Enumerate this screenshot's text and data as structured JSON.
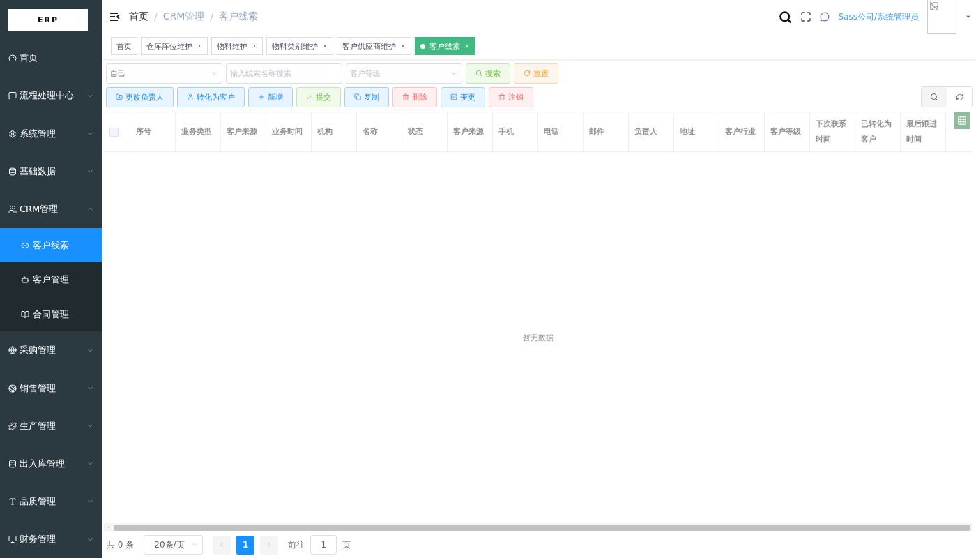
{
  "logo": {
    "text": "ERP"
  },
  "sidebar": {
    "items": [
      {
        "label": "首页"
      },
      {
        "label": "流程处理中心",
        "expanded": false
      },
      {
        "label": "系统管理",
        "expanded": false
      },
      {
        "label": "基础数据",
        "expanded": false
      },
      {
        "label": "CRM管理",
        "expanded": true,
        "children": [
          {
            "label": "客户线索",
            "selected": true
          },
          {
            "label": "客户管理",
            "selected": false
          },
          {
            "label": "合同管理",
            "selected": false
          }
        ]
      },
      {
        "label": "采购管理",
        "expanded": false
      },
      {
        "label": "销售管理",
        "expanded": false
      },
      {
        "label": "生产管理",
        "expanded": false
      },
      {
        "label": "出入库管理",
        "expanded": false
      },
      {
        "label": "品质管理",
        "expanded": false
      },
      {
        "label": "财务管理",
        "expanded": false
      }
    ]
  },
  "breadcrumb": {
    "items": [
      "首页",
      "CRM管理",
      "客户线索"
    ],
    "separator": "/"
  },
  "user": {
    "name": "Sass公司/系统管理员"
  },
  "tabs": [
    {
      "label": "首页",
      "selected": false,
      "closable": false
    },
    {
      "label": "仓库库位维护",
      "selected": false,
      "closable": true
    },
    {
      "label": "物料维护",
      "selected": false,
      "closable": true
    },
    {
      "label": "物料类别维护",
      "selected": false,
      "closable": true
    },
    {
      "label": "客户供应商维护",
      "selected": false,
      "closable": true
    },
    {
      "label": "客户线索",
      "selected": true,
      "closable": true
    }
  ],
  "filters": {
    "owner": {
      "value": "自己"
    },
    "search": {
      "placeholder": "输入线索名称搜索"
    },
    "level": {
      "placeholder": "客户等级"
    },
    "buttons": [
      {
        "label": "搜索",
        "kind": "success"
      },
      {
        "label": "重置",
        "kind": "warning"
      }
    ]
  },
  "actions": [
    {
      "label": "更改负责人",
      "kind": "primary"
    },
    {
      "label": "转化为客户",
      "kind": "primary"
    },
    {
      "label": "新增",
      "kind": "primary"
    },
    {
      "label": "提交",
      "kind": "success"
    },
    {
      "label": "复制",
      "kind": "primary"
    },
    {
      "label": "删除",
      "kind": "danger"
    },
    {
      "label": "变更",
      "kind": "primary"
    },
    {
      "label": "注销",
      "kind": "danger"
    }
  ],
  "table": {
    "select_all": {
      "checked": false
    },
    "columns": [
      "序号",
      "业务类型",
      "客户来源",
      "业务时间",
      "机构",
      "名称",
      "状态",
      "客户来源",
      "手机",
      "电话",
      "邮件",
      "负责人",
      "地址",
      "客户行业",
      "客户等级",
      "下次联系时间",
      "已转化为客户",
      "最后跟进时间"
    ],
    "empty_text": "暂无数据"
  },
  "pagination": {
    "total": "共 0 条",
    "page_size": "20条/页",
    "pages": [
      {
        "label": "1",
        "selected": true
      }
    ],
    "goto_label": "前往",
    "goto_value": "1",
    "page_suffix": "页"
  }
}
